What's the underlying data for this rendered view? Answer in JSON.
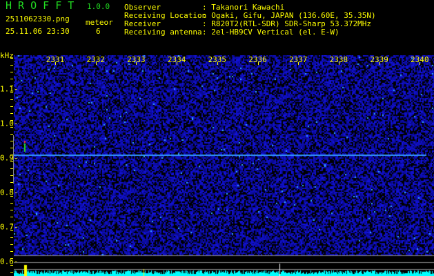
{
  "app": {
    "logo": "H R O F F T",
    "version": "1.0.0"
  },
  "file": {
    "name": "2511062330.png",
    "datetime": "25.11.06 23:30"
  },
  "meteor": {
    "label": "meteor",
    "count": "6"
  },
  "info": [
    {
      "label": "Observer",
      "value": ": Takanori Kawachi"
    },
    {
      "label": "Receiving Location",
      "value": ": Ogaki, Gifu, JAPAN (136.60E, 35.35N)"
    },
    {
      "label": "Receiver",
      "value": ": R820T2(RTL-SDR) SDR-Sharp 53.372MHz"
    },
    {
      "label": "Receiving antenna",
      "value": ": 2el-HB9CV Vertical (el. E-W)"
    }
  ],
  "axis": {
    "y_unit": "kHz",
    "x_ticks": [
      "2331",
      "2332",
      "2333",
      "2334",
      "2335",
      "2336",
      "2337",
      "2338",
      "2339",
      "2340"
    ],
    "y_ticks": [
      "1.1",
      "1.0",
      "0.9",
      "0.8",
      "0.7",
      "0.6"
    ]
  },
  "colors": {
    "text": "#ffff00",
    "logo": "#22dd22",
    "noise": "#1a1ad0",
    "signal": "#3399ff",
    "spectrum": "#00ffff"
  }
}
